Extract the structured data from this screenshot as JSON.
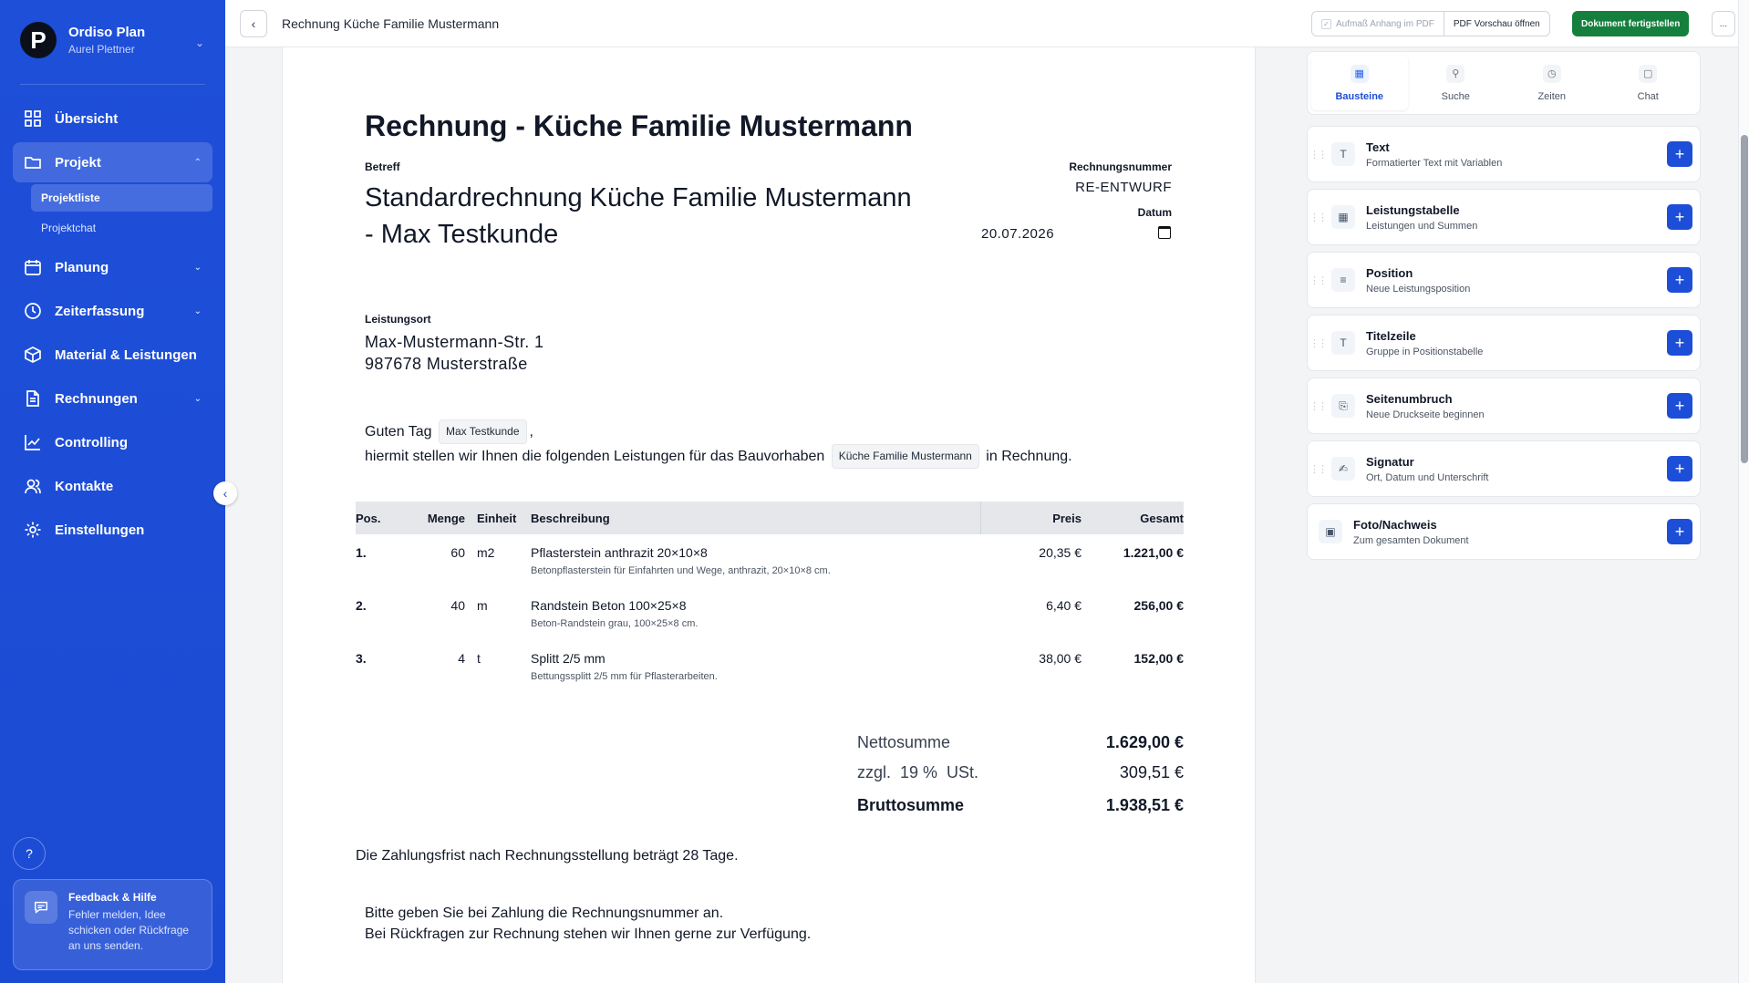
{
  "app": {
    "name": "Ordiso Plan",
    "user": "Aurel Plettner",
    "logo_letter": "P"
  },
  "nav": {
    "items": [
      {
        "label": "Übersicht"
      },
      {
        "label": "Projekt"
      },
      {
        "label": "Planung"
      },
      {
        "label": "Zeiterfassung"
      },
      {
        "label": "Material & Leistungen"
      },
      {
        "label": "Rechnungen"
      },
      {
        "label": "Controlling"
      },
      {
        "label": "Kontakte"
      },
      {
        "label": "Einstellungen"
      }
    ],
    "sub_items": [
      {
        "label": "Projektliste",
        "active": true
      },
      {
        "label": "Projektchat",
        "active": false
      }
    ]
  },
  "feedback": {
    "title": "Feedback & Hilfe",
    "text": "Fehler melden, Idee schicken oder Rückfrage an uns senden."
  },
  "topbar": {
    "title": "Rechnung Küche Familie Mustermann",
    "aufmass_label": "Aufmaß Anhang im PDF",
    "pdf_label": "PDF Vorschau öffnen",
    "finish_label": "Dokument fertigstellen",
    "more_label": "..."
  },
  "document": {
    "heading": "Rechnung - Küche Familie Mustermann",
    "betreff_label": "Betreff",
    "betreff_line1": "Standardrechnung Küche Familie Mustermann",
    "betreff_line2": "- Max Testkunde",
    "rechnungsnummer_label": "Rechnungsnummer",
    "rechnungsnummer": "RE-ENTWURF",
    "datum_label": "Datum",
    "datum": "20.07.2026",
    "leistungsort_label": "Leistungsort",
    "leistungsort_line1": "Max-Mustermann-Str. 1",
    "leistungsort_line2": "987678 Musterstraße",
    "greeting_prefix": "Guten Tag",
    "greeting_chip": "Max Testkunde",
    "greeting_suffix": ",",
    "intro_prefix": "hiermit stellen wir Ihnen die folgenden Leistungen für das Bauvorhaben",
    "intro_chip": "Küche Familie Mustermann",
    "intro_suffix": "in Rechnung.",
    "table": {
      "headers": {
        "pos": "Pos.",
        "menge": "Menge",
        "einheit": "Einheit",
        "beschreibung": "Beschreibung",
        "preis": "Preis",
        "gesamt": "Gesamt"
      },
      "rows": [
        {
          "pos": "1.",
          "menge": "60",
          "einheit": "m2",
          "title": "Pflasterstein anthrazit 20×10×8",
          "sub": "Betonpflasterstein für Einfahrten und Wege, anthrazit, 20×10×8 cm.",
          "preis": "20,35 €",
          "gesamt": "1.221,00 €"
        },
        {
          "pos": "2.",
          "menge": "40",
          "einheit": "m",
          "title": "Randstein Beton 100×25×8",
          "sub": "Beton-Randstein grau, 100×25×8 cm.",
          "preis": "6,40 €",
          "gesamt": "256,00 €"
        },
        {
          "pos": "3.",
          "menge": "4",
          "einheit": "t",
          "title": "Splitt 2/5 mm",
          "sub": "Bettungssplitt 2/5 mm für Pflasterarbeiten.",
          "preis": "38,00 €",
          "gesamt": "152,00 €"
        }
      ]
    },
    "totals": {
      "netto_label": "Nettosumme",
      "netto": "1.629,00 €",
      "ust_label": "zzgl.  19 %  USt.",
      "ust": "309,51 €",
      "brutto_label": "Bruttosumme",
      "brutto": "1.938,51 €"
    },
    "zahlungsfrist": "Die Zahlungsfrist nach Rechnungsstellung beträgt 28 Tage.",
    "closing_line1": "Bitte geben Sie bei Zahlung die Rechnungsnummer an.",
    "closing_line2": "Bei Rückfragen zur Rechnung stehen wir Ihnen gerne zur Verfügung."
  },
  "panel": {
    "tabs": [
      {
        "label": "Bausteine",
        "icon": "blocks-icon"
      },
      {
        "label": "Suche",
        "icon": "search-icon"
      },
      {
        "label": "Zeiten",
        "icon": "clock-icon"
      },
      {
        "label": "Chat",
        "icon": "chat-icon"
      }
    ],
    "blocks": [
      {
        "title": "Text",
        "sub": "Formatierter Text mit Variablen"
      },
      {
        "title": "Leistungstabelle",
        "sub": "Leistungen und Summen"
      },
      {
        "title": "Position",
        "sub": "Neue Leistungsposition"
      },
      {
        "title": "Titelzeile",
        "sub": "Gruppe in Positionstabelle"
      },
      {
        "title": "Seitenumbruch",
        "sub": "Neue Druckseite beginnen"
      },
      {
        "title": "Signatur",
        "sub": "Ort, Datum und Unterschrift"
      },
      {
        "title": "Foto/Nachweis",
        "sub": "Zum gesamten Dokument"
      }
    ]
  },
  "colors": {
    "sidebar": "#1d4ed8",
    "primary_green": "#15803d",
    "add_button": "#1d4ed8"
  }
}
